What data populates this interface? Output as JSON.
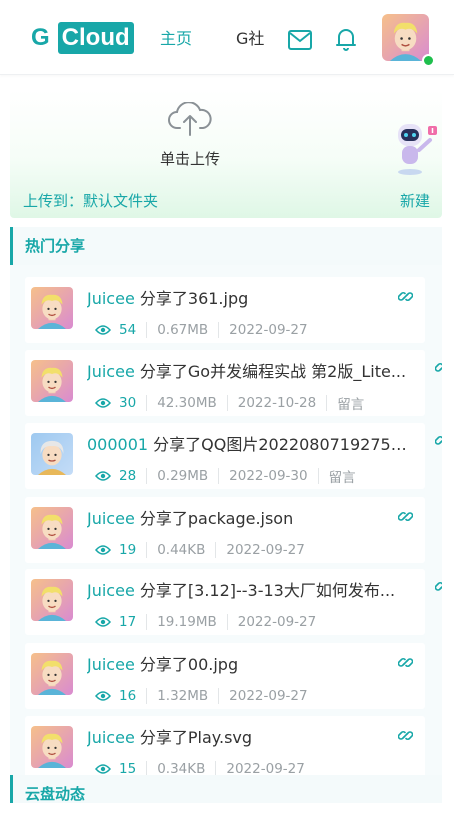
{
  "header": {
    "logo_g": "G",
    "logo_cloud": "Cloud",
    "nav_home": "主页",
    "nav_gshe": "G社",
    "colors": {
      "accent": "#18a7a8",
      "online": "#1fbf4d"
    },
    "icons": [
      "mail-icon",
      "bell-icon"
    ]
  },
  "upload": {
    "action": "单击上传",
    "target": "上传到：默认文件夹",
    "new": "新建"
  },
  "sections": {
    "hot_share": "热门分享",
    "cloud_activity": "云盘动态"
  },
  "shares": [
    {
      "user": "Juicee",
      "text": "分享了361.jpg",
      "views": "54",
      "size": "0.67MB",
      "date": "2022-09-27",
      "comment": ""
    },
    {
      "user": "Juicee",
      "text": "分享了Go并发编程实战 第2版_Lite...",
      "views": "30",
      "size": "42.30MB",
      "date": "2022-10-28",
      "comment": "留言"
    },
    {
      "user": "000001",
      "text": "分享了QQ图片20220807192753...",
      "views": "28",
      "size": "0.29MB",
      "date": "2022-09-30",
      "comment": "留言"
    },
    {
      "user": "Juicee",
      "text": "分享了package.json",
      "views": "19",
      "size": "0.44KB",
      "date": "2022-09-27",
      "comment": ""
    },
    {
      "user": "Juicee",
      "text": "分享了[3.12]--3-13大厂如何发布...",
      "views": "17",
      "size": "19.19MB",
      "date": "2022-09-27",
      "comment": ""
    },
    {
      "user": "Juicee",
      "text": "分享了00.jpg",
      "views": "16",
      "size": "1.32MB",
      "date": "2022-09-27",
      "comment": ""
    },
    {
      "user": "Juicee",
      "text": "分享了Play.svg",
      "views": "15",
      "size": "0.34KB",
      "date": "2022-09-27",
      "comment": ""
    }
  ]
}
